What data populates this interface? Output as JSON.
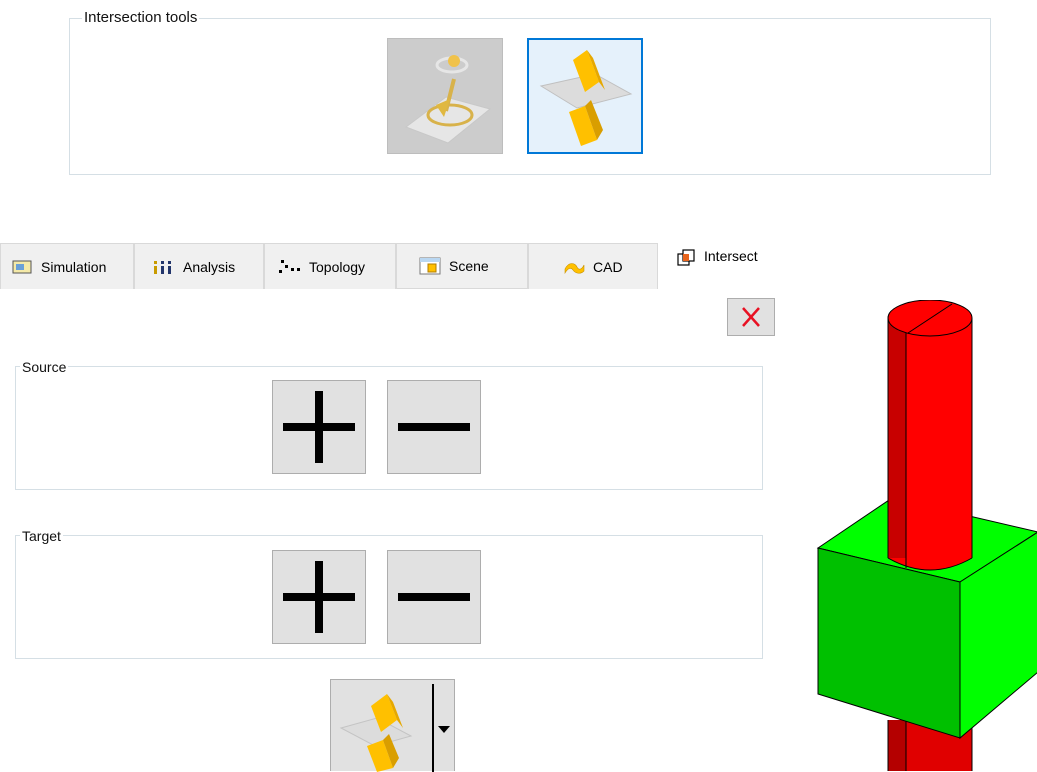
{
  "intersection_tools": {
    "title": "Intersection tools",
    "buttons": [
      {
        "name": "project-point-tool",
        "icon": "project-point-icon",
        "state": "disabled"
      },
      {
        "name": "intersect-planes-tool",
        "icon": "intersect-planes-icon",
        "state": "selected"
      }
    ]
  },
  "tabs": [
    {
      "label": "Simulation",
      "icon": "simulation-icon"
    },
    {
      "label": "Analysis",
      "icon": "analysis-icon"
    },
    {
      "label": "Topology",
      "icon": "topology-icon"
    },
    {
      "label": "Scene",
      "icon": "scene-icon"
    },
    {
      "label": "CAD",
      "icon": "cad-icon"
    },
    {
      "label": "Intersect",
      "icon": "intersect-icon",
      "active": true
    }
  ],
  "close_button": {
    "icon": "close-icon",
    "color": "#e81123"
  },
  "source": {
    "title": "Source",
    "add_icon": "plus-icon",
    "remove_icon": "minus-icon"
  },
  "target": {
    "title": "Target",
    "add_icon": "plus-icon",
    "remove_icon": "minus-icon"
  },
  "split_button": {
    "icon": "intersect-planes-icon",
    "dropdown_icon": "chevron-down-icon"
  },
  "viewport": {
    "objects": [
      {
        "name": "cylinder",
        "color": "#ff0000"
      },
      {
        "name": "cube",
        "color": "#00ff00"
      }
    ]
  }
}
